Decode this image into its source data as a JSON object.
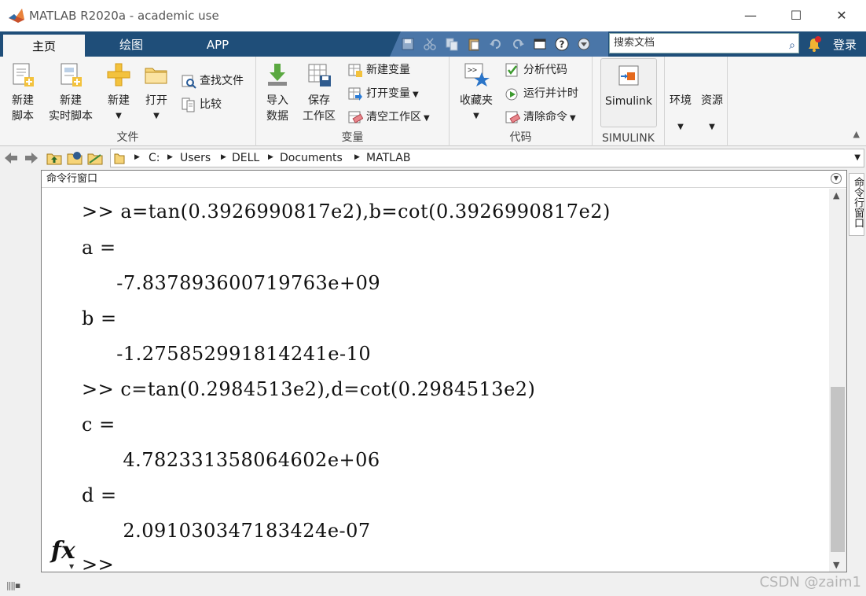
{
  "window": {
    "title": "MATLAB R2020a - academic use",
    "minimize_glyph": "—",
    "maximize_glyph": "☐",
    "close_glyph": "✕"
  },
  "tabs": [
    {
      "label": "主页",
      "active": true
    },
    {
      "label": "绘图",
      "active": false
    },
    {
      "label": "APP",
      "active": false
    }
  ],
  "search": {
    "placeholder": "搜索文档"
  },
  "account": {
    "login_label": "登录"
  },
  "ribbon": {
    "file": {
      "title": "文件",
      "new_script": [
        "新建",
        "脚本"
      ],
      "new_live_script": [
        "新建",
        "实时脚本"
      ],
      "new": "新建",
      "open": "打开",
      "find_files": "查找文件",
      "compare": "比较"
    },
    "variable": {
      "title": "变量",
      "import_data": [
        "导入",
        "数据"
      ],
      "save_workspace": [
        "保存",
        "工作区"
      ],
      "new_variable": "新建变量",
      "open_variable": "打开变量",
      "clear_workspace": "清空工作区"
    },
    "code": {
      "title": "代码",
      "favorites": "收藏夹",
      "analyze_code": "分析代码",
      "run_and_time": "运行并计时",
      "clear_commands": "清除命令"
    },
    "simulink": {
      "title": "SIMULINK",
      "button": "Simulink"
    },
    "environment": "环境",
    "resources": "资源"
  },
  "path": {
    "crumbs": [
      "C:",
      "Users",
      "DELL",
      "Documents",
      "MATLAB"
    ]
  },
  "command_window": {
    "title": "命令行窗口",
    "side_tab": "命令行窗口",
    "lines": [
      ">> a=tan(0.3926990817e2),b=cot(0.3926990817e2)",
      "a =",
      "  -7.837893600719763e+09",
      "b =",
      "  -1.275852991814241e-10",
      ">> c=tan(0.2984513e2),d=cot(0.2984513e2)",
      "c =",
      "   4.782331358064602e+06",
      "d =",
      "   2.091030347183424e-07",
      ">>"
    ],
    "fx_label": "fx"
  },
  "watermark": "CSDN @zaim1"
}
